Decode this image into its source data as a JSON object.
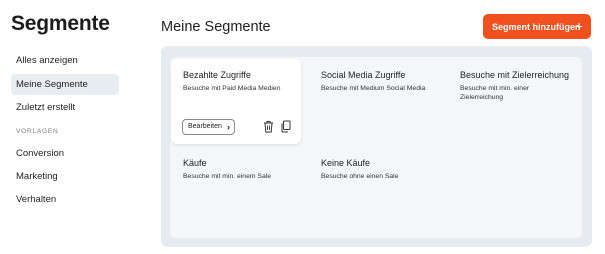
{
  "sidebar": {
    "title": "Segmente",
    "items": [
      {
        "label": "Alles anzeigen"
      },
      {
        "label": "Meine Segmente"
      },
      {
        "label": "Zuletzt erstellt"
      }
    ],
    "section_label": "VORLAGEN",
    "templates": [
      {
        "label": "Conversion"
      },
      {
        "label": "Marketing"
      },
      {
        "label": "Verhalten"
      }
    ]
  },
  "header": {
    "title": "Meine Segmente",
    "add_button_label": "Segment hinzufügen",
    "add_icon": "+"
  },
  "segments": [
    {
      "title": "Bezahlte Zugriffe",
      "description": "Besuche mit Paid Media Medien"
    },
    {
      "title": "Social Media Zugriffe",
      "description": "Besuche mit Medium Social Media"
    },
    {
      "title": "Besuche mit Zielerreichung",
      "description": "Besuche mit min. einer Zielerreichung"
    },
    {
      "title": "Käufe",
      "description": "Besuche mit min. einem Sale"
    },
    {
      "title": "Keine Käufe",
      "description": "Besuche ohne einen Sale"
    }
  ],
  "card_actions": {
    "edit_label": "Bearbeiten",
    "edit_icon": "chevron-right-icon",
    "delete_icon": "trash-icon",
    "copy_icon": "copy-icon"
  },
  "colors": {
    "accent": "#f0511e",
    "active_nav_bg": "#e8edf2",
    "panel_bg": "#e6ebf0"
  }
}
